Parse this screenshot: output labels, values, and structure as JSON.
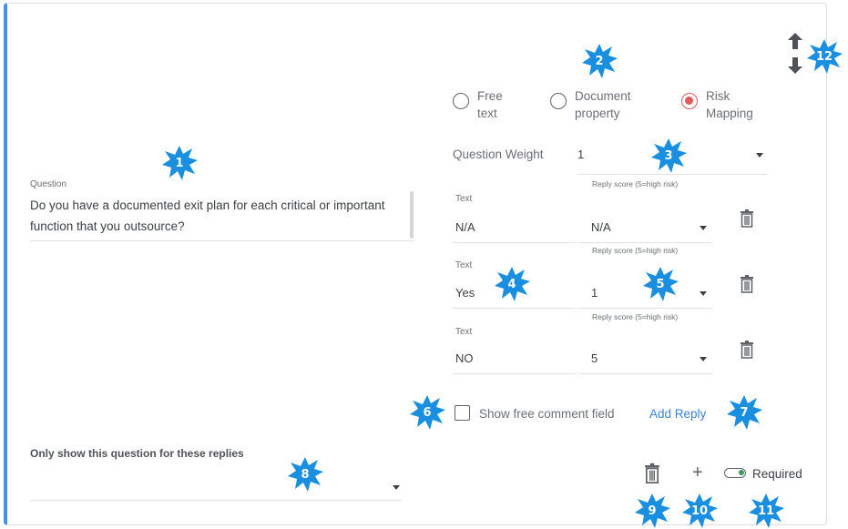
{
  "question": {
    "label": "Question",
    "text": "Do you have a documented exit plan for each critical or important function that you outsource?"
  },
  "answer_type": {
    "options": [
      {
        "label_line1": "Free",
        "label_line2": "text",
        "selected": false
      },
      {
        "label_line1": "Document",
        "label_line2": "property",
        "selected": false
      },
      {
        "label_line1": "Risk",
        "label_line2": "Mapping",
        "selected": true
      }
    ]
  },
  "question_weight": {
    "label": "Question Weight",
    "value": "1"
  },
  "replies": [
    {
      "text_label": "Text",
      "text_value": "N/A",
      "score_label": "Reply score (5=high risk)",
      "score_value": "N/A"
    },
    {
      "text_label": "Text",
      "text_value": "Yes",
      "score_label": "Reply score (5=high risk)",
      "score_value": "1"
    },
    {
      "text_label": "Text",
      "text_value": "NO",
      "score_label": "Reply score (5=high risk)",
      "score_value": "5"
    }
  ],
  "free_comment": {
    "label": "Show free comment field",
    "checked": false
  },
  "add_reply_label": "Add Reply",
  "only_show": {
    "label": "Only show this question for these replies",
    "value": ""
  },
  "footer": {
    "required_label": "Required",
    "required_on": true,
    "plus_symbol": "+"
  },
  "reorder": {
    "up_icon": "arrow-up-icon",
    "down_icon": "arrow-down-icon"
  },
  "badges": [
    "1",
    "2",
    "3",
    "4",
    "5",
    "6",
    "7",
    "8",
    "9",
    "10",
    "11",
    "12"
  ],
  "colors": {
    "accent_border": "#4a90e2",
    "radio_selected": "#e05a5a",
    "link": "#3b82d6",
    "badge": "#1a8fe0",
    "toggle_on": "#3a9a5a"
  }
}
